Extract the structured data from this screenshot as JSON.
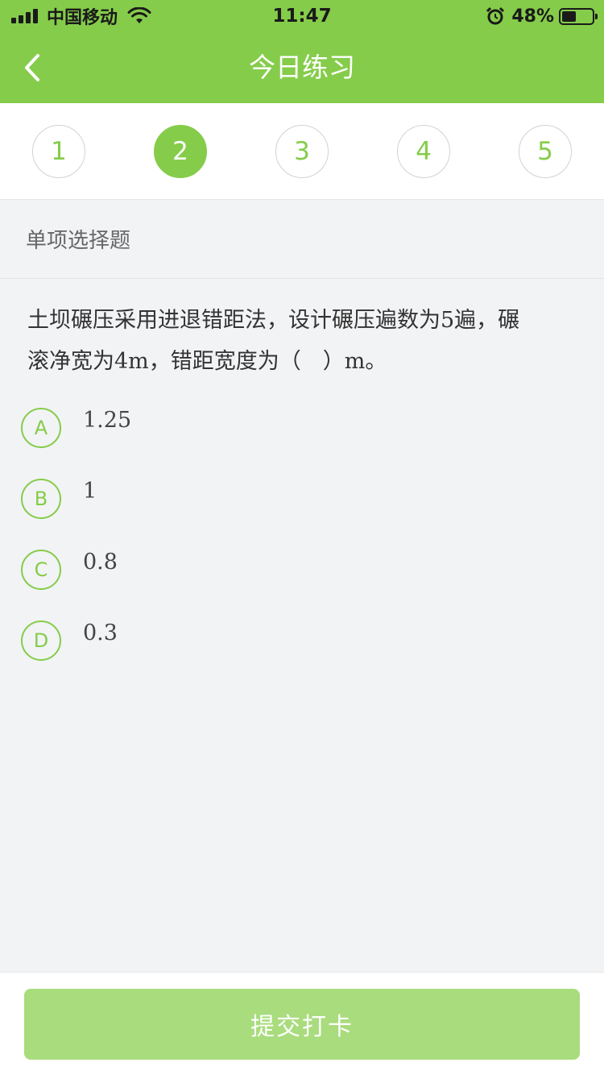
{
  "status_bar": {
    "carrier": "中国移动",
    "time": "11:47",
    "battery_pct": "48%",
    "battery_level": 0.48
  },
  "nav": {
    "title": "今日练习",
    "back_icon": "chevron-left-icon"
  },
  "question_index": {
    "items": [
      "1",
      "2",
      "3",
      "4",
      "5"
    ],
    "active": "2"
  },
  "question": {
    "type_label": "单项选择题",
    "text_line1": "土坝碾压采用进退错距法，设计碾压遍数为5遍，碾",
    "text_line2": "滚净宽为4m，错距宽度为（　）m。",
    "options": [
      {
        "letter": "A",
        "text": "1.25"
      },
      {
        "letter": "B",
        "text": "1"
      },
      {
        "letter": "C",
        "text": "0.8"
      },
      {
        "letter": "D",
        "text": "0.3"
      }
    ]
  },
  "footer": {
    "submit_label": "提交打卡"
  },
  "colors": {
    "brand_green": "#85cc4a",
    "submit_disabled": "#a9dc7d",
    "background": "#f2f3f5"
  }
}
